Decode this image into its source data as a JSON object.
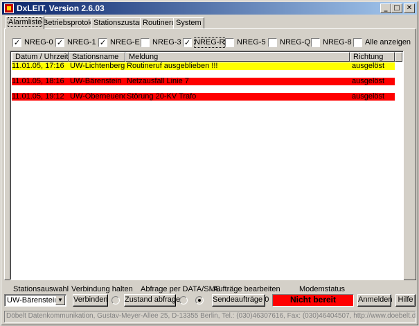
{
  "window": {
    "title": "DxLEIT, Version 2.6.03",
    "controls": {
      "minimize": "_",
      "maximize": "□",
      "close": "✕"
    }
  },
  "tabs": [
    {
      "label": "Alarmliste",
      "active": true
    },
    {
      "label": "Betriebsprotokoll"
    },
    {
      "label": "Stationszustand"
    },
    {
      "label": "Routineruf"
    },
    {
      "label": "System"
    }
  ],
  "filters": [
    {
      "label": "NREG-0",
      "checked": true
    },
    {
      "label": "NREG-1",
      "checked": true
    },
    {
      "label": "NREG-E",
      "checked": true
    },
    {
      "label": "NREG-3",
      "checked": false
    },
    {
      "label": "NREG-R",
      "checked": true
    },
    {
      "label": "NREG-5",
      "checked": false
    },
    {
      "label": "NREG-Q",
      "checked": false
    },
    {
      "label": "NREG-8",
      "checked": false
    },
    {
      "label": "Alle anzeigen",
      "checked": false
    }
  ],
  "alarm_table": {
    "columns": [
      "Datum / Uhrzeit",
      "Stationsname",
      "Meldung",
      "Richtung"
    ],
    "rows": [
      {
        "datetime": "11.01.05, 17:16",
        "station": "UW-Lichtenberg",
        "message": "Routineruf ausgeblieben !!!",
        "direction": "ausgelöst",
        "color": "#ffff00"
      },
      {
        "datetime": "11.01.05, 18:16",
        "station": "UW-Bärenstein",
        "message": "Netzausfall Linie 7",
        "direction": "ausgelöst",
        "color": "#ff0000"
      },
      {
        "datetime": "11.01.05, 19:12",
        "station": "UW-Oberneuendorf",
        "message": "Störung 20-KV Trafo",
        "direction": "ausgelöst",
        "color": "#ff0000"
      }
    ]
  },
  "bottom": {
    "station_select_label": "Stationsauswahl",
    "station_selected": "UW-Bärenstein",
    "connection_label": "Verbindung  halten",
    "connect_button": "Verbinden",
    "query_label": "Abfrage per DATA/SMS",
    "query_button": "Zustand abfragen",
    "orders_label": "Aufträge bearbeiten",
    "orders_button": "Sendeaufträge 0",
    "modem_label": "Modemstatus",
    "modem_status": "Nicht bereit",
    "modem_color": "#ff0000",
    "login_button": "Anmelden",
    "help_button": "Hilfe"
  },
  "statusbar": {
    "text": "Döbelt Datenkommunikation, Gustav-Meyer-Allee 25, D-13355 Berlin, Tel.: (030)46307616, Fax: (030)46404507, http://www.doebelt.de"
  }
}
